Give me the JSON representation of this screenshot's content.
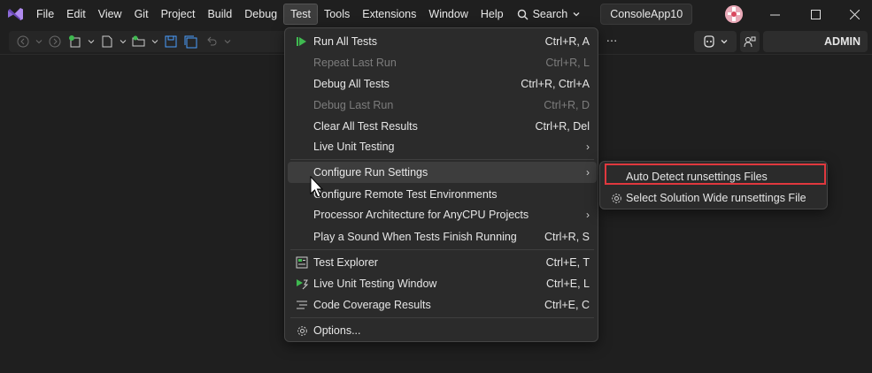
{
  "menubar": {
    "items": [
      "File",
      "Edit",
      "View",
      "Git",
      "Project",
      "Build",
      "Debug",
      "Test",
      "Tools",
      "Extensions",
      "Window",
      "Help"
    ],
    "active": "Test",
    "search_label": "Search",
    "solution_name": "ConsoleApp10"
  },
  "toolbar": {
    "user_label": "ADMIN"
  },
  "test_menu": {
    "items": [
      {
        "label": "Run All Tests",
        "shortcut": "Ctrl+R, A",
        "icon": "run-all-icon",
        "disabled": false,
        "submenu": false
      },
      {
        "label": "Repeat Last Run",
        "shortcut": "Ctrl+R, L",
        "icon": "",
        "disabled": true,
        "submenu": false
      },
      {
        "label": "Debug All Tests",
        "shortcut": "Ctrl+R, Ctrl+A",
        "icon": "",
        "disabled": false,
        "submenu": false
      },
      {
        "label": "Debug Last Run",
        "shortcut": "Ctrl+R, D",
        "icon": "",
        "disabled": true,
        "submenu": false
      },
      {
        "label": "Clear All Test Results",
        "shortcut": "Ctrl+R, Del",
        "icon": "",
        "disabled": false,
        "submenu": false
      },
      {
        "label": "Live Unit Testing",
        "shortcut": "",
        "icon": "",
        "disabled": false,
        "submenu": true
      },
      {
        "label": "Configure Run Settings",
        "shortcut": "",
        "icon": "",
        "disabled": false,
        "submenu": true
      },
      {
        "label": "Configure Remote Test Environments",
        "shortcut": "",
        "icon": "",
        "disabled": false,
        "submenu": false
      },
      {
        "label": "Processor Architecture for AnyCPU Projects",
        "shortcut": "",
        "icon": "",
        "disabled": false,
        "submenu": true
      },
      {
        "label": "Play a Sound When Tests Finish Running",
        "shortcut": "Ctrl+R, S",
        "icon": "",
        "disabled": false,
        "submenu": false
      },
      {
        "label": "Test Explorer",
        "shortcut": "Ctrl+E, T",
        "icon": "test-explorer-icon",
        "disabled": false,
        "submenu": false
      },
      {
        "label": "Live Unit Testing Window",
        "shortcut": "Ctrl+E, L",
        "icon": "live-unit-testing-icon",
        "disabled": false,
        "submenu": false
      },
      {
        "label": "Code Coverage Results",
        "shortcut": "Ctrl+E, C",
        "icon": "code-coverage-icon",
        "disabled": false,
        "submenu": false
      },
      {
        "label": "Options...",
        "shortcut": "",
        "icon": "gear-icon",
        "disabled": false,
        "submenu": false
      }
    ]
  },
  "run_settings_submenu": {
    "items": [
      {
        "label": "Auto Detect runsettings Files",
        "icon": "",
        "highlighted": true
      },
      {
        "label": "Select Solution Wide runsettings File",
        "icon": "gear-icon",
        "highlighted": false
      }
    ]
  },
  "colors": {
    "background": "#1f1f1f",
    "menu_background": "#2b2b2b",
    "highlight_border": "#e0383e",
    "run_icon_green": "#3fb950",
    "vs_purple": "#8e6cd8"
  }
}
